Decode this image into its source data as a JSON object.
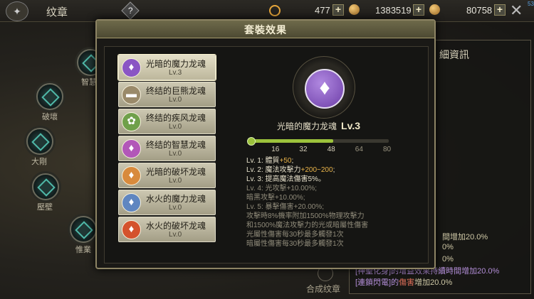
{
  "header": {
    "title": "纹章",
    "help_icon": "?",
    "currencies": [
      {
        "value": "477"
      },
      {
        "value": "1383519"
      },
      {
        "value": "80758"
      }
    ],
    "corner_text": "53"
  },
  "left_nodes": [
    {
      "label": "智慧"
    },
    {
      "label": "破壞"
    },
    {
      "label": "大剛"
    },
    {
      "label": "壓壁"
    },
    {
      "label": "惟業"
    }
  ],
  "compose_label": "合成纹章",
  "right_panel": {
    "title": "細資訊",
    "lines": [
      {
        "pre": "",
        "hl": "",
        "post": "間增加20.0%"
      },
      {
        "pre": "",
        "hl": "",
        "post": "0%"
      },
      {
        "pre": "",
        "hl": "",
        "post": "0%"
      },
      {
        "pre": "[神聖化身]的增益效果持續時間增加20.0%",
        "hl": "",
        "post": ""
      },
      {
        "pre": "[連鎖閃電]的",
        "hl": "傷害",
        "post": "增加20.0%"
      }
    ]
  },
  "modal": {
    "title": "套裝效果",
    "items": [
      {
        "name": "光暗的魔力龙魂",
        "level": "Lv.3",
        "icon_color": "#8a55c4",
        "icon": "♦"
      },
      {
        "name": "终结的巨熊龙魂",
        "level": "Lv.0",
        "icon_color": "#9a8a6a",
        "icon": "▬"
      },
      {
        "name": "终结的疾风龙魂",
        "level": "Lv.0",
        "icon_color": "#6fa04a",
        "icon": "✿"
      },
      {
        "name": "终结的智慧龙魂",
        "level": "Lv.0",
        "icon_color": "#b257b8",
        "icon": "♦"
      },
      {
        "name": "光暗的破坏龙魂",
        "level": "Lv.0",
        "icon_color": "#d88a3c",
        "icon": "♦"
      },
      {
        "name": "水火的魔力龙魂",
        "level": "Lv.0",
        "icon_color": "#5f86c0",
        "icon": "♦"
      },
      {
        "name": "水火的破坏龙魂",
        "level": "Lv.0",
        "icon_color": "#d4522c",
        "icon": "♦"
      }
    ],
    "detail": {
      "name": "光暗的魔力龙魂",
      "level": "Lv.3",
      "progress": {
        "value": 48,
        "max": 80,
        "milestones": [
          "16",
          "32",
          "48",
          "64",
          "80"
        ]
      },
      "effects": [
        {
          "text": "Lv. 1:  體質",
          "bonus": "+50",
          "tail": ";",
          "active": true
        },
        {
          "text": "Lv. 2:  魔法攻擊力",
          "bonus": "+200~200",
          "tail": ";",
          "active": true
        },
        {
          "text": "Lv. 3:  提高魔法傷害5%。",
          "bonus": "",
          "tail": "",
          "active": true
        },
        {
          "text": "Lv. 4:  光攻擊+10.00%;",
          "bonus": "",
          "tail": "",
          "active": false
        },
        {
          "text": "          暗黑攻擊+10.00%;",
          "bonus": "",
          "tail": "",
          "active": false
        },
        {
          "text": "Lv. 5:  暴擊傷害+20.00%;",
          "bonus": "",
          "tail": "",
          "active": false
        },
        {
          "text": "          攻擊時8%機率附加1500%物理攻擊力",
          "bonus": "",
          "tail": "",
          "active": false
        },
        {
          "text": "          和1500%魔法攻擊力的光或暗屬性傷害",
          "bonus": "",
          "tail": "",
          "active": false
        },
        {
          "text": "          光屬性傷害每30秒最多觸發1次",
          "bonus": "",
          "tail": "",
          "active": false
        },
        {
          "text": "          暗屬性傷害每30秒最多觸發1次",
          "bonus": "",
          "tail": "",
          "active": false
        }
      ]
    }
  }
}
